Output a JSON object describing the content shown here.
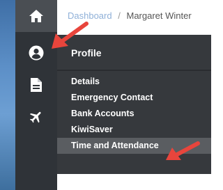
{
  "breadcrumb": {
    "link": "Dashboard",
    "separator": "/",
    "current": "Margaret Winter"
  },
  "sidebar": {
    "items": [
      {
        "name": "home",
        "icon": "home-icon"
      },
      {
        "name": "profile",
        "icon": "user-icon"
      },
      {
        "name": "documents",
        "icon": "document-icon"
      },
      {
        "name": "travel",
        "icon": "airplane-icon"
      }
    ]
  },
  "flyout": {
    "title": "Profile",
    "items": [
      {
        "label": "Details"
      },
      {
        "label": "Emergency Contact"
      },
      {
        "label": "Bank Accounts"
      },
      {
        "label": "KiwiSaver"
      },
      {
        "label": "Time and Attendance",
        "active": true
      }
    ]
  },
  "colors": {
    "sidebar": "#2f3338",
    "flyout": "#36393d",
    "active_item": "#5a5d61",
    "annotation_arrow": "#e8453c",
    "breadcrumb_link": "#8fb0d8"
  }
}
